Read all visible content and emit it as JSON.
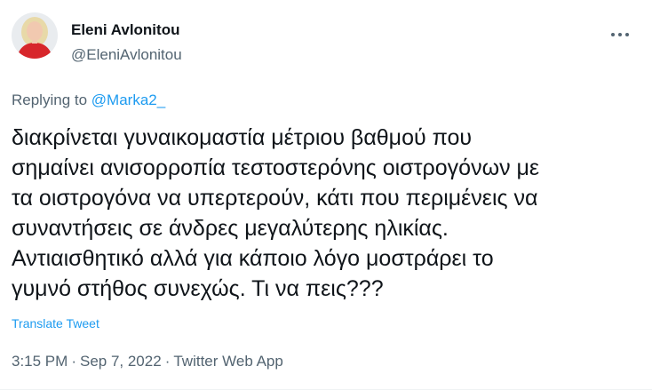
{
  "tweet": {
    "author": {
      "name": "Eleni Avlonitou",
      "handle": "@EleniAvlonitou"
    },
    "more_icon": "ellipsis-icon",
    "reply": {
      "prefix": "Replying to",
      "target": "@Marka2_"
    },
    "body_lines": [
      "διακρίνεται γυναικομαστία μέτριου βαθμού που",
      "σημαίνει ανισορροπία τεστοστερόνης οιστρογόνων με",
      "τα οιστρογόνα να υπερτερούν, κάτι που περιμένεις να",
      "συναντήσεις σε άνδρες μεγαλύτερης ηλικίας.",
      "Αντιαισθητικό αλλά για κάποιο λόγο μοστράρει το",
      "γυμνό στήθος συνεχώς. Τι να πεις???"
    ],
    "translate_label": "Translate Tweet",
    "meta": {
      "time": "3:15 PM",
      "date": "Sep 7, 2022",
      "source": "Twitter Web App"
    },
    "colors": {
      "link": "#1d9bf0",
      "secondary": "#536471",
      "text": "#0f1419"
    }
  }
}
